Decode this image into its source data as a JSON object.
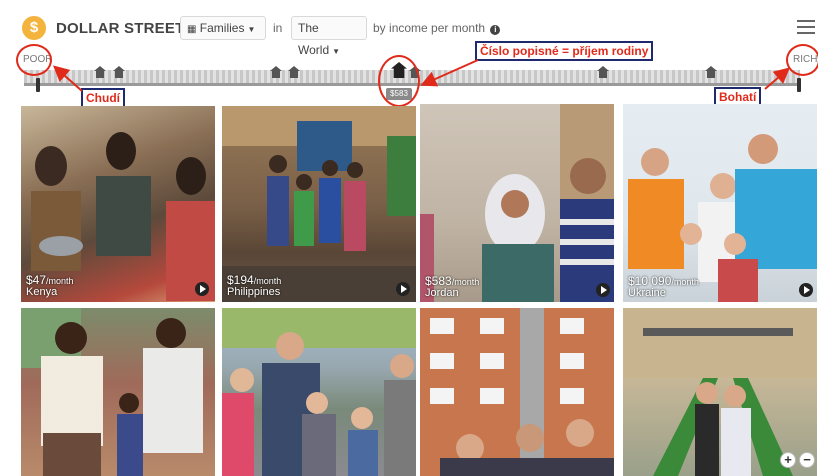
{
  "header": {
    "logo_symbol": "$",
    "brand": "DOLLAR STREET",
    "families_select": "Families",
    "in_text": "in",
    "region_select": "The World",
    "by_text": "by",
    "income_text": "income per month",
    "info_symbol": "i"
  },
  "strip": {
    "poor_label": "POOR",
    "rich_label": "RICH",
    "selected_price": "$583"
  },
  "annotations": {
    "chudi": "Chudí",
    "bohati": "Bohatí",
    "cislo": "Číslo popisné = příjem rodiny",
    "color": "#e02a1a"
  },
  "cards": [
    {
      "price": "$47",
      "per": "/month",
      "country": "Kenya"
    },
    {
      "price": "$194",
      "per": "/month",
      "country": "Philippines"
    },
    {
      "price": "$583",
      "per": "/month",
      "country": "Jordan"
    },
    {
      "price": "$10 090",
      "per": "/month",
      "country": "Ukraine"
    },
    {
      "price": "",
      "per": "",
      "country": ""
    },
    {
      "price": "",
      "per": "",
      "country": ""
    },
    {
      "price": "",
      "per": "",
      "country": ""
    },
    {
      "price": "",
      "per": "",
      "country": ""
    }
  ],
  "zoom": {
    "plus": "+",
    "minus": "−"
  }
}
